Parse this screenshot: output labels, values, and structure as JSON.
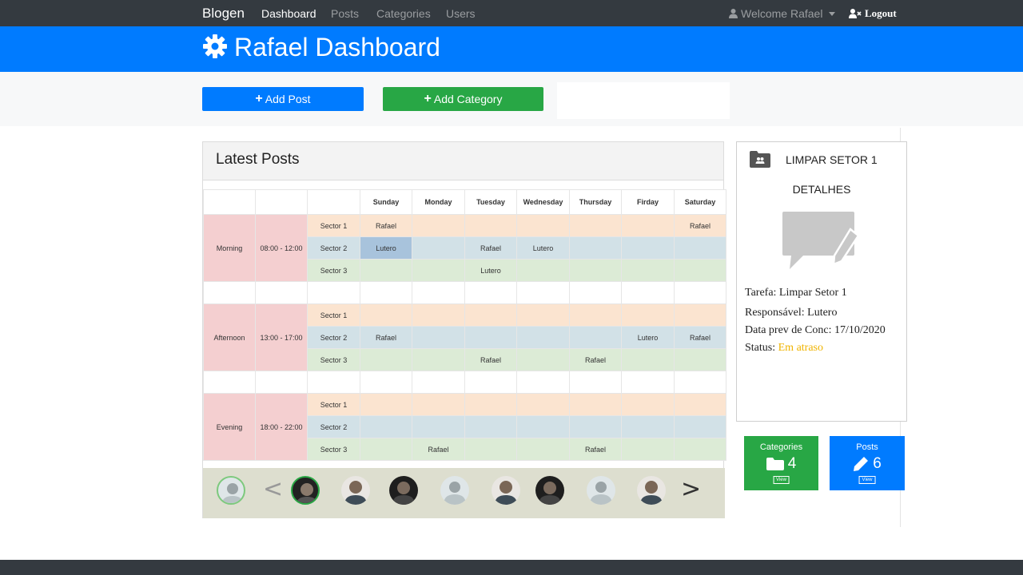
{
  "navbar": {
    "brand": "Blogen",
    "links": [
      "Dashboard",
      "Posts",
      "Categories",
      "Users"
    ],
    "welcome": "Welcome Rafael",
    "logout": "Logout"
  },
  "header": {
    "title": "Rafael Dashboard"
  },
  "actions": {
    "add_post": "Add Post",
    "add_category": "Add Category"
  },
  "posts": {
    "title": "Latest Posts",
    "days": [
      "Sunday",
      "Monday",
      "Tuesday",
      "Wednesday",
      "Thursday",
      "Firday",
      "Saturday"
    ],
    "shifts": [
      {
        "name": "Morning",
        "time": "08:00 - 12:00",
        "rows": [
          {
            "sector": "Sector 1",
            "cells": [
              "Rafael",
              "",
              "",
              "",
              "",
              "",
              "Rafael"
            ]
          },
          {
            "sector": "Sector 2",
            "cells": [
              "Lutero",
              "",
              "Rafael",
              "Lutero",
              "",
              "",
              ""
            ]
          },
          {
            "sector": "Sector 3",
            "cells": [
              "",
              "",
              "Lutero",
              "",
              "",
              "",
              ""
            ]
          }
        ]
      },
      {
        "name": "Afternoon",
        "time": "13:00 - 17:00",
        "rows": [
          {
            "sector": "Sector 1",
            "cells": [
              "",
              "",
              "",
              "",
              "",
              "",
              ""
            ]
          },
          {
            "sector": "Sector 2",
            "cells": [
              "Rafael",
              "",
              "",
              "",
              "",
              "Lutero",
              "Rafael"
            ]
          },
          {
            "sector": "Sector 3",
            "cells": [
              "",
              "",
              "Rafael",
              "",
              "Rafael",
              "",
              ""
            ]
          }
        ]
      },
      {
        "name": "Evening",
        "time": "18:00 - 22:00",
        "rows": [
          {
            "sector": "Sector 1",
            "cells": [
              "",
              "",
              "",
              "",
              "",
              "",
              ""
            ]
          },
          {
            "sector": "Sector 2",
            "cells": [
              "",
              "",
              "",
              "",
              "",
              "",
              ""
            ]
          },
          {
            "sector": "Sector 3",
            "cells": [
              "",
              "Rafael",
              "",
              "",
              "Rafael",
              "",
              ""
            ]
          }
        ]
      }
    ],
    "carousel": {
      "prev": "<",
      "next": ">"
    }
  },
  "task": {
    "title": "LIMPAR SETOR 1",
    "details": "DETALHES",
    "tarefa": "Tarefa: Limpar Setor 1",
    "responsavel": "Responsável: Lutero",
    "data": "Data prev de Conc: 17/10/2020",
    "status_label": "Status: ",
    "status_value": "Em atraso"
  },
  "stats": {
    "categories": {
      "label": "Categories",
      "value": "4",
      "view": "View"
    },
    "posts": {
      "label": "Posts",
      "value": "6",
      "view": "View"
    }
  },
  "colors": {
    "primary": "#007bff",
    "success": "#28a745",
    "dark": "#343a40",
    "status": "#f0b400"
  }
}
